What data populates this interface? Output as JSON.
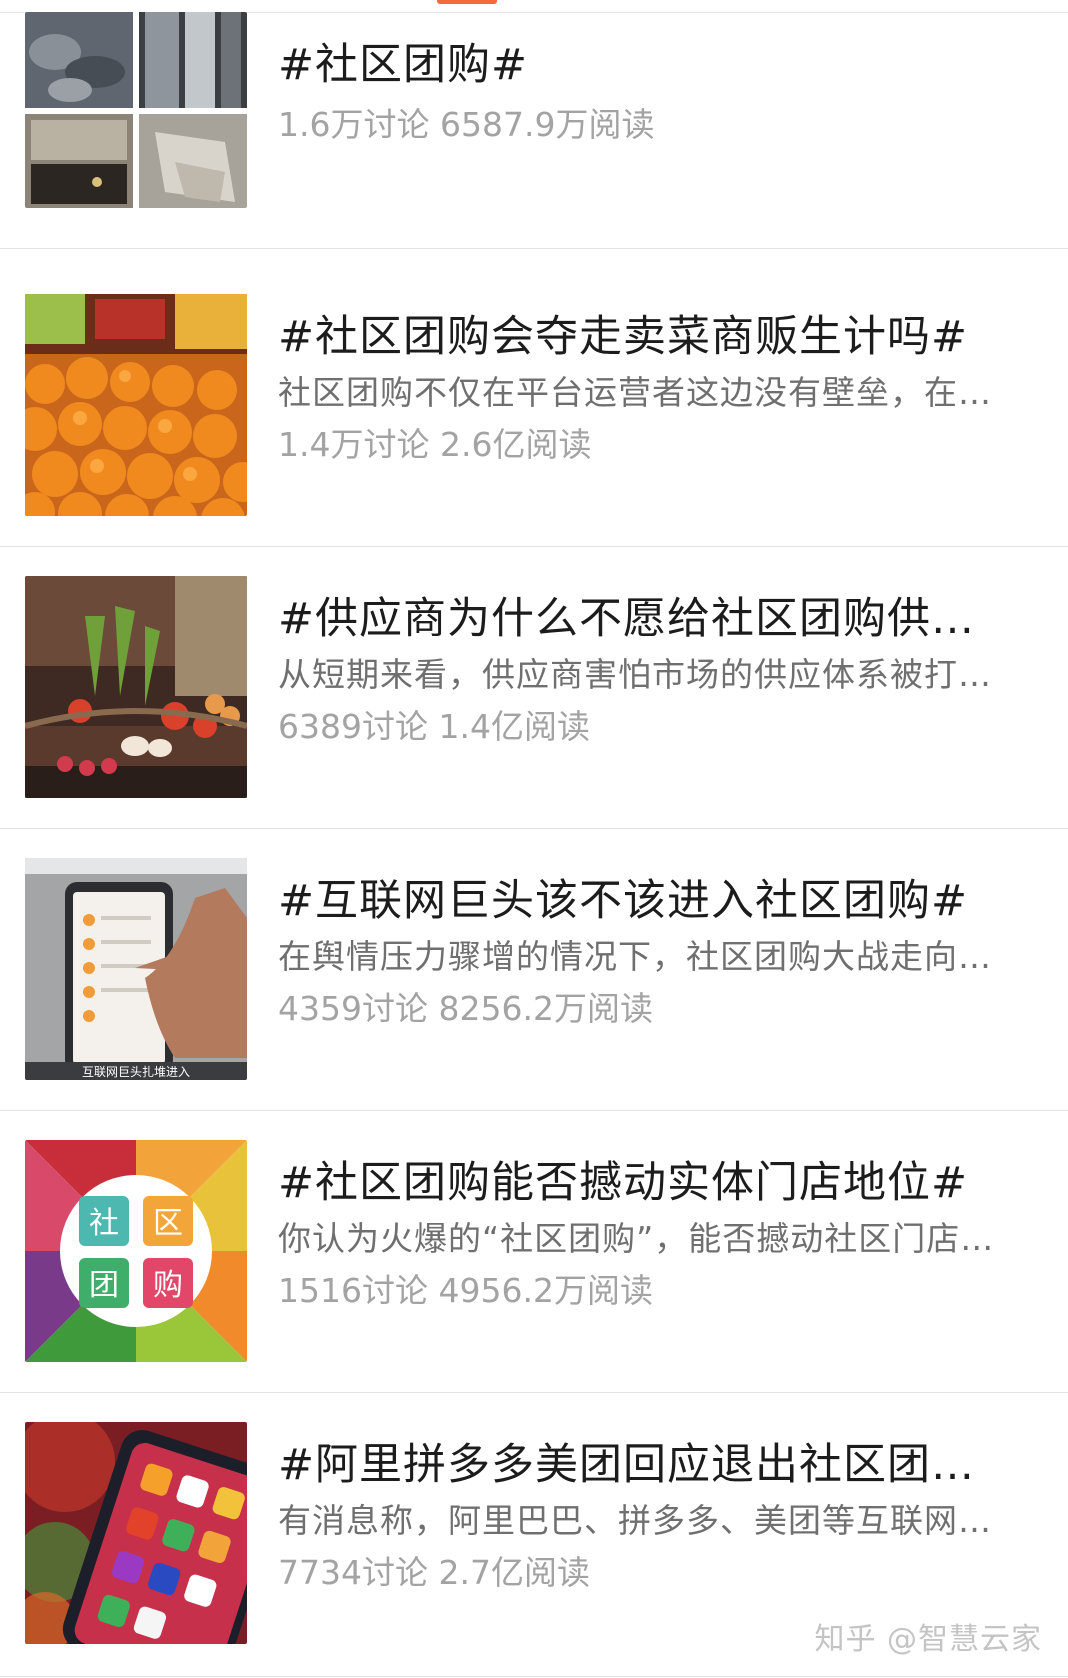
{
  "topics": [
    {
      "title": "#社区团购#",
      "description": "",
      "discussions": "1.6万讨论",
      "reads": "6587.9万阅读"
    },
    {
      "title": "#社区团购会夺走卖菜商贩生计吗#",
      "description": "社区团购不仅在平台运营者这边没有壁垒，在…",
      "discussions": "1.4万讨论",
      "reads": "2.6亿阅读"
    },
    {
      "title": "#供应商为什么不愿给社区团购供…",
      "description": "从短期来看，供应商害怕市场的供应体系被打…",
      "discussions": "6389讨论",
      "reads": "1.4亿阅读"
    },
    {
      "title": "#互联网巨头该不该进入社区团购#",
      "description": "在舆情压力骤增的情况下，社区团购大战走向…",
      "discussions": "4359讨论",
      "reads": "8256.2万阅读"
    },
    {
      "title": "#社区团购能否撼动实体门店地位#",
      "description": "你认为火爆的“社区团购”，能否撼动社区门店…",
      "discussions": "1516讨论",
      "reads": "4956.2万阅读"
    },
    {
      "title": "#阿里拼多多美团回应退出社区团…",
      "description": "有消息称，阿里巴巴、拼多多、美团等互联网…",
      "discussions": "7734讨论",
      "reads": "2.7亿阅读"
    }
  ],
  "thumbnails": {
    "phone_caption": "互联网巨头扎堆进入",
    "puzzle_chars": [
      "社",
      "区",
      "团",
      "购"
    ]
  },
  "watermark": "知乎 @智慧云家"
}
